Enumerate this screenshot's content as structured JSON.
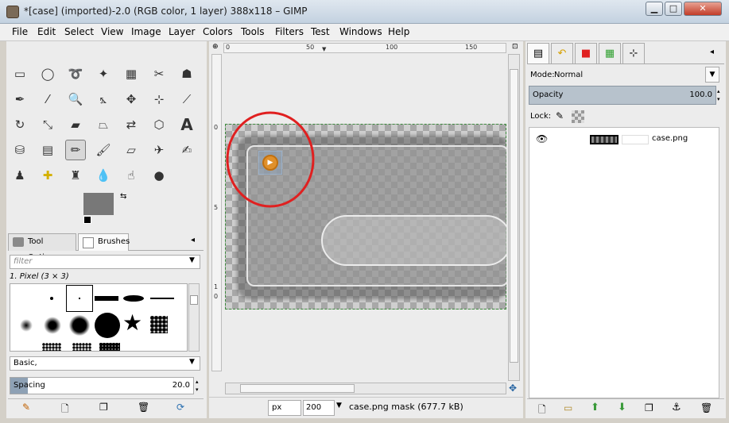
{
  "window": {
    "title": "*[case] (imported)-2.0 (RGB color, 1 layer) 388x118 – GIMP",
    "minimize": "▁",
    "maximize": "□",
    "close": "✕"
  },
  "menu": [
    "File",
    "Edit",
    "Select",
    "View",
    "Image",
    "Layer",
    "Colors",
    "Tools",
    "Filters",
    "Test",
    "Windows",
    "Help"
  ],
  "toolbox": {
    "tabs": [
      "Tool Options",
      "Brushes"
    ],
    "filter_placeholder": "filter",
    "brush_name": "1. Pixel (3 × 3)",
    "preset": "Basic,",
    "spacing_label": "Spacing",
    "spacing_value": "20.0"
  },
  "canvas": {
    "ruler_top": [
      "0",
      "50",
      "100",
      "150"
    ],
    "ruler_left": [
      "0",
      "5",
      "1",
      "0"
    ]
  },
  "status": {
    "unit": "px",
    "zoom": "200",
    "info": "case.png mask (677.7 kB)"
  },
  "layers": {
    "mode_label": "Mode:",
    "mode_value": "Normal",
    "opacity_label": "Opacity",
    "opacity_value": "100.0",
    "lock_label": "Lock:",
    "layer_name": "case.png"
  },
  "colors": {
    "highlight_circle": "#e02020",
    "selection_fill": "#8ea1b5"
  }
}
